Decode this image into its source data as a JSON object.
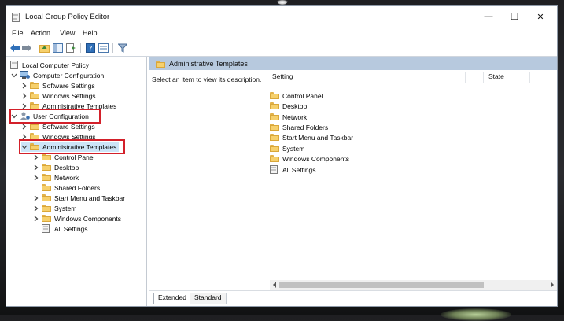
{
  "window": {
    "title": "Local Group Policy Editor",
    "controls": {
      "minimize": "—",
      "maximize": "☐",
      "close": "✕"
    }
  },
  "menu": [
    "File",
    "Action",
    "View",
    "Help"
  ],
  "toolbar_icons": [
    "back-arrow-icon",
    "forward-arrow-icon",
    "up-folder-icon",
    "show-hide-tree-icon",
    "export-list-icon",
    "help-icon",
    "properties-icon",
    "filter-icon"
  ],
  "tree": {
    "root": "Local Computer Policy",
    "computer_configuration": {
      "label": "Computer Configuration",
      "children": [
        "Software Settings",
        "Windows Settings",
        "Administrative Templates"
      ]
    },
    "user_configuration": {
      "label": "User Configuration",
      "children": [
        "Software Settings",
        "Windows Settings"
      ],
      "admin_templates": {
        "label": "Administrative Templates",
        "children": [
          "Control Panel",
          "Desktop",
          "Network",
          "Shared Folders",
          "Start Menu and Taskbar",
          "System",
          "Windows Components",
          "All Settings"
        ]
      }
    }
  },
  "right_pane": {
    "header": "Administrative Templates",
    "description": "Select an item to view its description.",
    "columns": {
      "setting": "Setting",
      "state": "State"
    },
    "items": [
      "Control Panel",
      "Desktop",
      "Network",
      "Shared Folders",
      "Start Menu and Taskbar",
      "System",
      "Windows Components",
      "All Settings"
    ]
  },
  "tabs": {
    "extended": "Extended",
    "standard": "Standard"
  },
  "colors": {
    "highlight_box": "#d3202a",
    "header_bar": "#b7c9de",
    "selected_row": "#cce4f7"
  }
}
